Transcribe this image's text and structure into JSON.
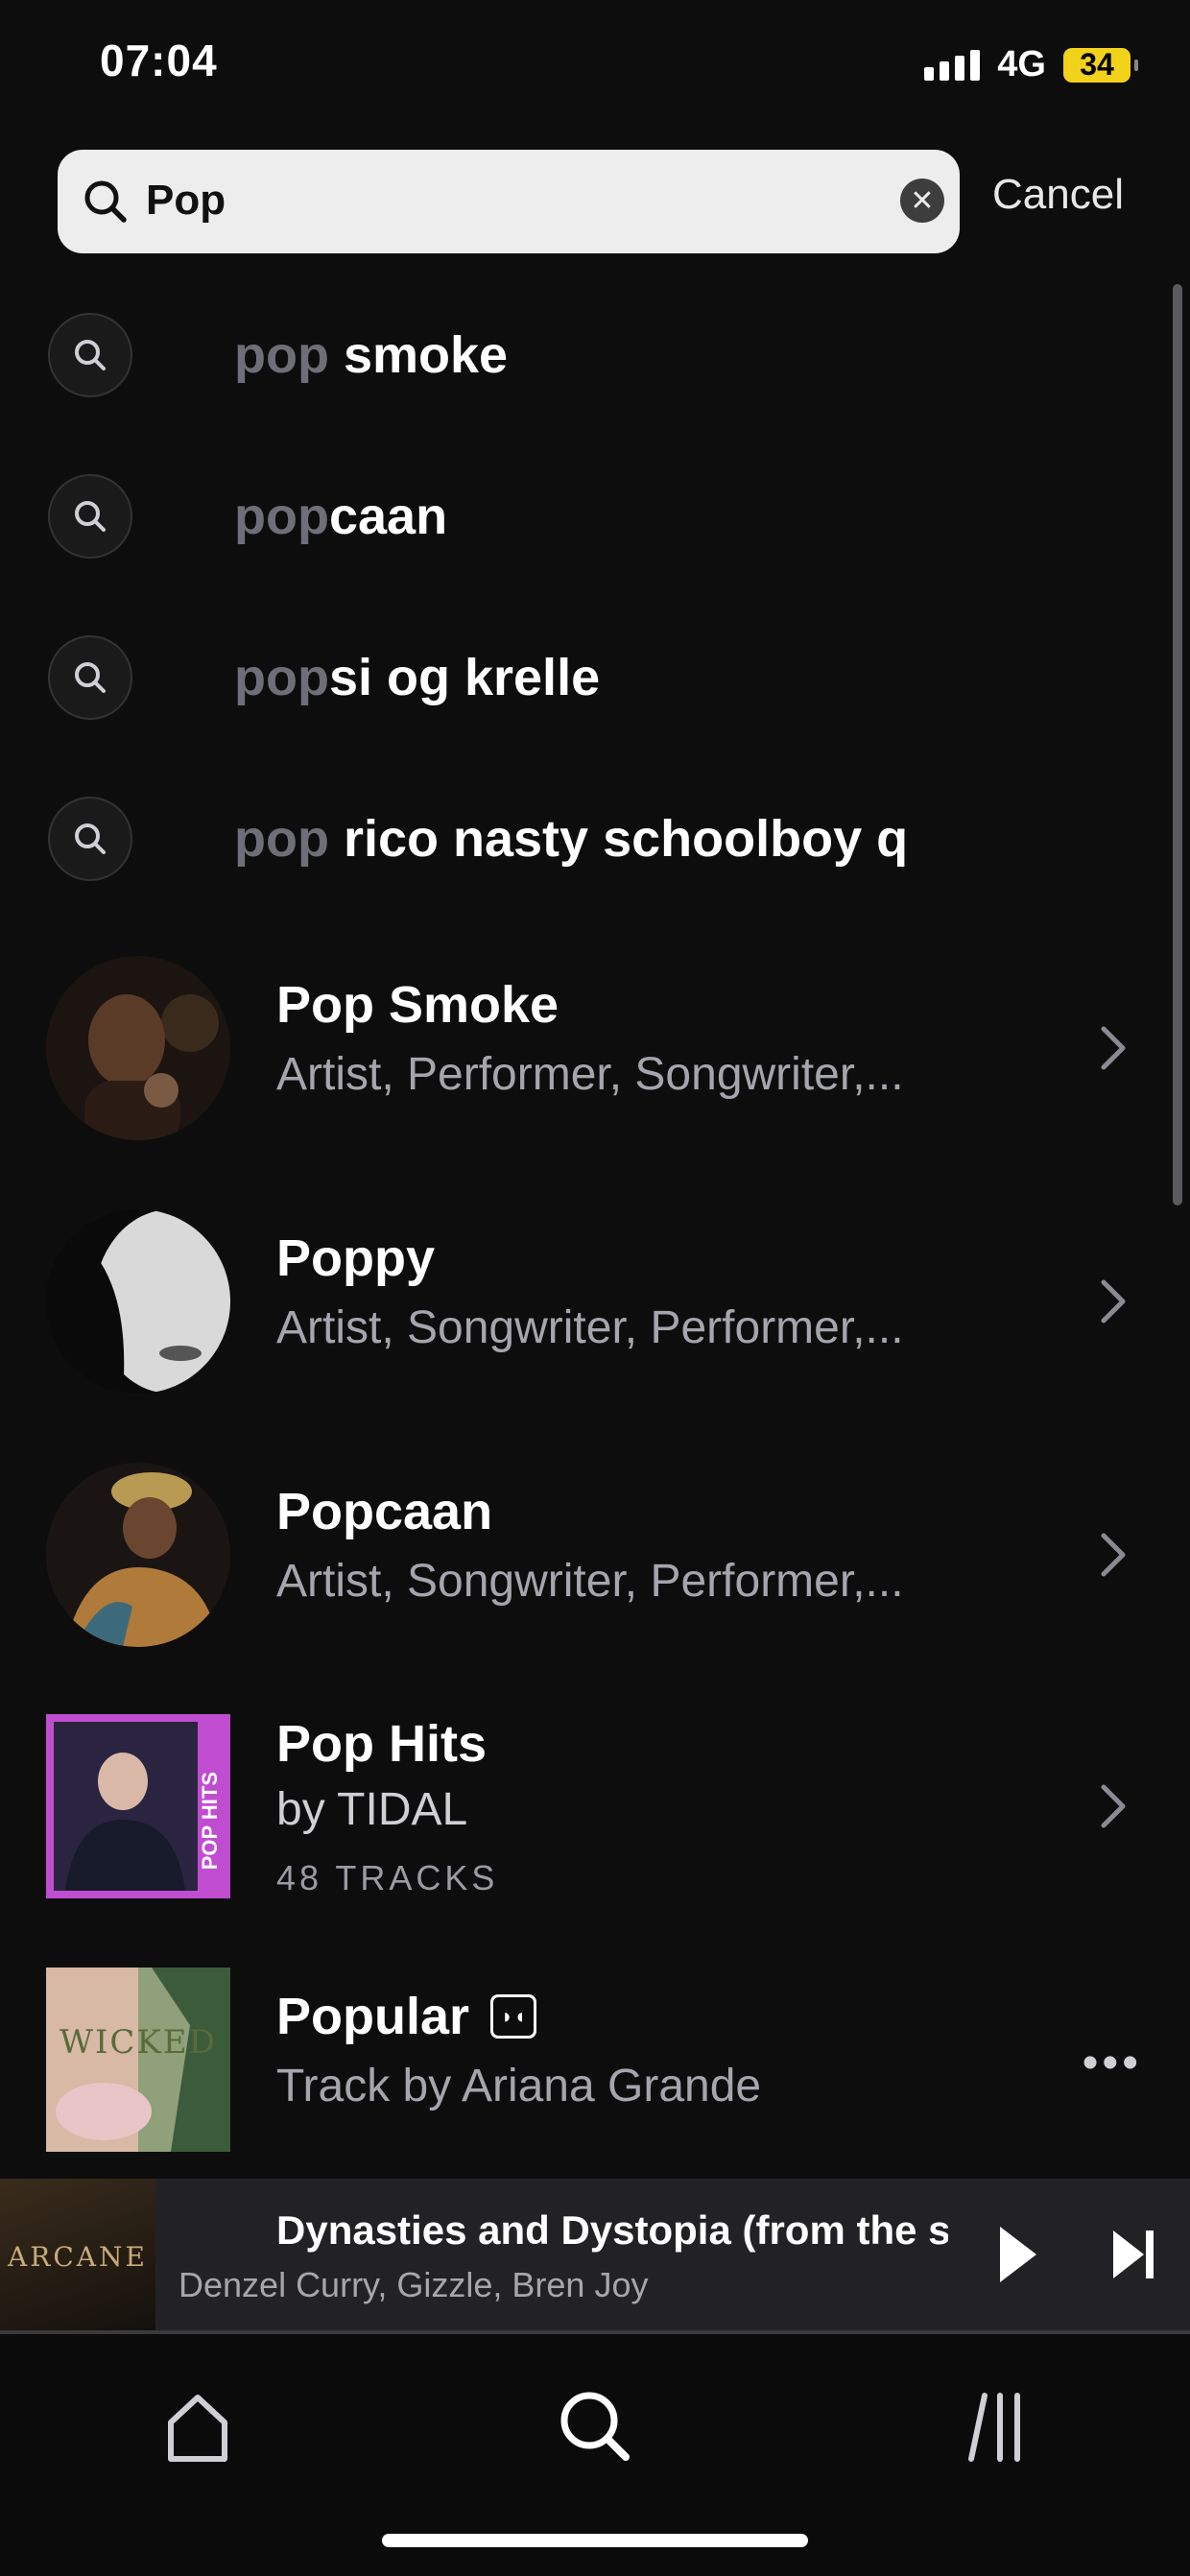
{
  "status_bar": {
    "time": "07:04",
    "network": "4G",
    "battery": "34"
  },
  "search": {
    "query": "Pop",
    "cancel_label": "Cancel"
  },
  "suggestions": [
    {
      "prefix": "pop",
      "rest": " smoke"
    },
    {
      "prefix": "pop",
      "rest": "caan"
    },
    {
      "prefix": "pop",
      "rest": "si og krelle"
    },
    {
      "prefix": "pop",
      "rest": " rico nasty schoolboy q"
    }
  ],
  "results": [
    {
      "title": "Pop Smoke",
      "subtitle": "Artist, Performer, Songwriter,..."
    },
    {
      "title": "Poppy",
      "subtitle": "Artist, Songwriter, Performer,..."
    },
    {
      "title": "Popcaan",
      "subtitle": "Artist, Songwriter, Performer,..."
    },
    {
      "title": "Pop Hits",
      "subtitle": "by TIDAL",
      "meta": "48 TRACKS",
      "badge": "POP HITS"
    },
    {
      "title": "Popular",
      "subtitle": "Track by Ariana Grande",
      "cover_text": "WICKED"
    }
  ],
  "mini_player": {
    "title": "Dynasties and Dystopia (from the s",
    "artist": "Denzel Curry, Gizzle, Bren Joy",
    "art_text": "ARCANE"
  },
  "tabs": [
    "home-icon",
    "search-icon",
    "library-icon"
  ],
  "colors": {
    "background": "#0d0d0e",
    "muted_text": "#6e6e78",
    "battery": "#f2d21b",
    "pop_hits_accent": "#c04dd0"
  }
}
